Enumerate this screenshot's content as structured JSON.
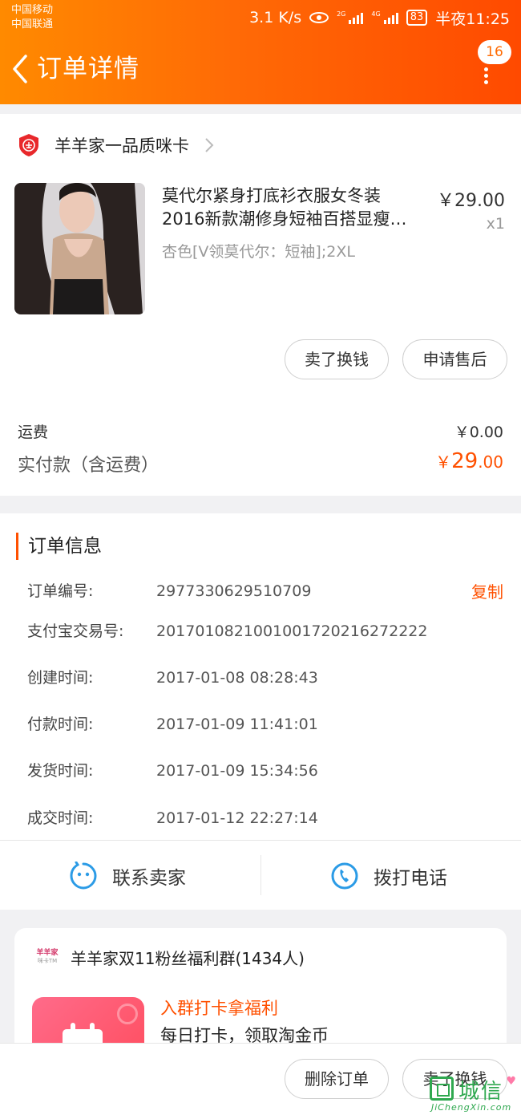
{
  "status_bar": {
    "carrier1": "中国移动",
    "carrier2": "中国联通",
    "speed": "3.1 K/s",
    "net1": "2G",
    "net2": "4G",
    "battery": "83",
    "time": "半夜11:25"
  },
  "header": {
    "title": "订单详情",
    "badge_count": "16"
  },
  "shop": {
    "name": "羊羊家一品质咪卡"
  },
  "product": {
    "title_line1": "莫代尔紧身打底衫衣服女冬装",
    "title_line2": "2016新款潮修身短袖百搭显瘦…",
    "price": "￥29.00",
    "quantity": "x1",
    "sku": "杏色[V领莫代尔：短袖];2XL",
    "sell_button": "卖了换钱",
    "aftersale_button": "申请售后"
  },
  "summary": {
    "shipping_label": "运费",
    "shipping_value": "￥0.00",
    "paid_label": "实付款（含运费）",
    "paid_currency": "￥",
    "paid_int": "29",
    "paid_dec": ".00"
  },
  "order_info": {
    "section_title": "订单信息",
    "copy_label": "复制",
    "rows": [
      {
        "label": "订单编号:",
        "value": "2977330629510709"
      },
      {
        "label": "支付宝交易号:",
        "value": "2017010821001001720216272222"
      },
      {
        "label": "创建时间:",
        "value": "2017-01-08 08:28:43"
      },
      {
        "label": "付款时间:",
        "value": "2017-01-09 11:41:01"
      },
      {
        "label": "发货时间:",
        "value": "2017-01-09 15:34:56"
      },
      {
        "label": "成交时间:",
        "value": "2017-01-12 22:27:14"
      }
    ]
  },
  "contact": {
    "seller_label": "联系卖家",
    "phone_label": "拨打电话"
  },
  "group": {
    "logo_line1": "羊羊家",
    "logo_line2": "咪卡TM",
    "name": "羊羊家双11粉丝福利群(1434人)",
    "promo_title": "入群打卡拿福利",
    "promo_sub": "每日打卡，领取淘金币"
  },
  "bottom": {
    "delete_button": "删除订单",
    "sell_button": "卖了换钱"
  },
  "watermark": {
    "text": "城信",
    "url": "JiChengXin.com"
  },
  "colors": {
    "accent": "#ff5000",
    "header_start": "#ff8a00",
    "header_end": "#ff4a00",
    "contact_icon": "#2b9be6"
  }
}
